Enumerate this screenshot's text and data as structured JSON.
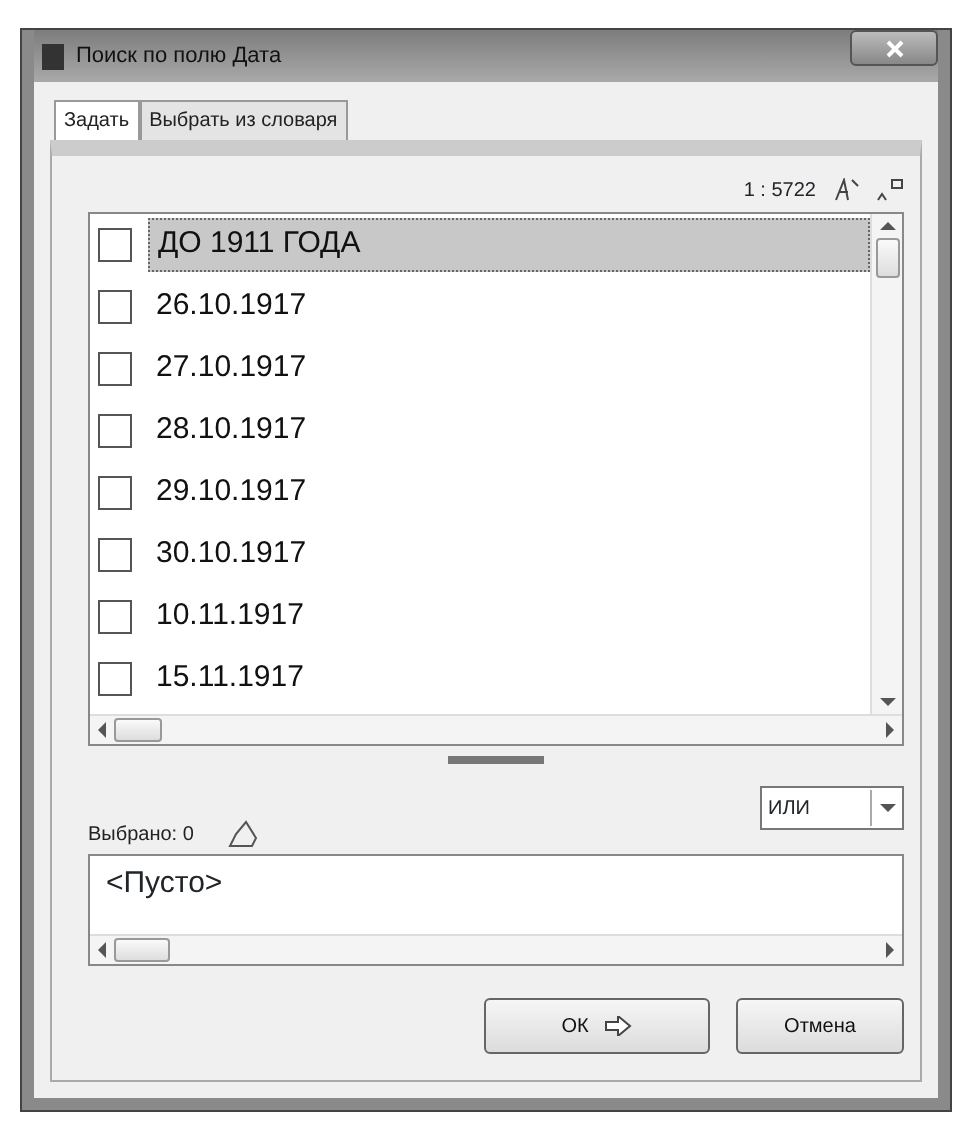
{
  "window": {
    "title": "Поиск по полю Дата"
  },
  "tabs": [
    {
      "label": "Задать",
      "selected": true
    },
    {
      "label": "Выбрать из словаря",
      "selected": false
    }
  ],
  "counter": "1 : 5722",
  "values": [
    {
      "label": "ДО 1911 ГОДА",
      "checked": false,
      "selected": true
    },
    {
      "label": "26.10.1917",
      "checked": false,
      "selected": false
    },
    {
      "label": "27.10.1917",
      "checked": false,
      "selected": false
    },
    {
      "label": "28.10.1917",
      "checked": false,
      "selected": false
    },
    {
      "label": "29.10.1917",
      "checked": false,
      "selected": false
    },
    {
      "label": "30.10.1917",
      "checked": false,
      "selected": false
    },
    {
      "label": "10.11.1917",
      "checked": false,
      "selected": false
    },
    {
      "label": "15.11.1917",
      "checked": false,
      "selected": false
    }
  ],
  "selected_count": "Выбрано: 0",
  "operator": {
    "value": "ИЛИ"
  },
  "selection_box": {
    "text": "<Пусто>"
  },
  "buttons": [
    {
      "label": "ОК",
      "kind": "ok"
    },
    {
      "label": "Отмена",
      "kind": "cancel"
    }
  ]
}
